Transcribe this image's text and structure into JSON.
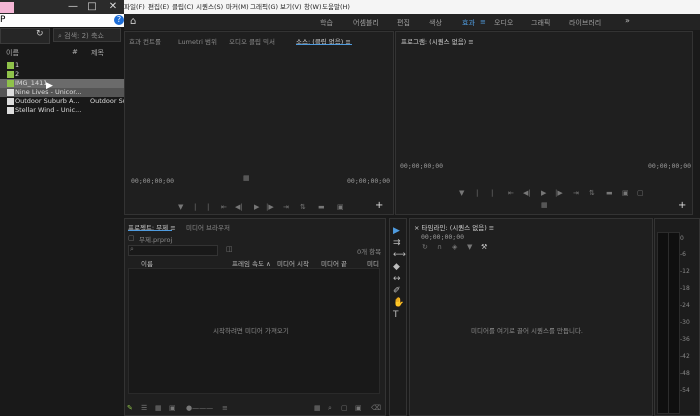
{
  "explorer": {
    "title_char": "P",
    "search_placeholder": "⌕ 검색: 2) 축쇼",
    "col_name": "이름",
    "col_hash": "#",
    "col_title": "제목",
    "help": "?",
    "refresh": "↻",
    "items": [
      {
        "label": "1",
        "extra": "",
        "type": "folder"
      },
      {
        "label": "2",
        "extra": "",
        "type": "folder"
      },
      {
        "label": "IMG_1411",
        "extra": "",
        "type": "folder"
      },
      {
        "label": "Nine Lives - Unicor...",
        "extra": "",
        "type": "file"
      },
      {
        "label": "Outdoor Suburb A...",
        "extra": "Outdoor Suburb",
        "type": "file"
      },
      {
        "label": "Stellar Wind - Unic...",
        "extra": "",
        "type": "file"
      }
    ],
    "win_min": "—",
    "win_max": "□",
    "win_close": "✕"
  },
  "menubar": {
    "items": [
      "파일(F)",
      "편집(E)",
      "클립(C)",
      "시퀀스(S)",
      "마커(M)",
      "그래픽(G)",
      "보기(V)",
      "창(W)",
      "도움말(H)"
    ]
  },
  "workspaces": {
    "home": "⌂",
    "items": [
      "학습",
      "어셈블리",
      "편집",
      "색상",
      "효과",
      "≡",
      "오디오",
      "그래픽",
      "라이브러리"
    ],
    "active_index": 4,
    "more": "»"
  },
  "source_panel": {
    "tabs": [
      "효과 컨트롤",
      "Lumetri 범위",
      "오디오 클립 믹서",
      "소스: (클립 없음) ≡"
    ],
    "timecode_left": "00;00;00;00",
    "timecode_right": "00;00;00;00",
    "plus": "+"
  },
  "program_panel": {
    "tab": "프로그램: (시퀀스 없음) ≡",
    "timecode_left": "00;00;00;00",
    "timecode_right": "00;00;00;00",
    "plus": "+"
  },
  "project_panel": {
    "tabs": [
      "프로젝트: 무제 ≡",
      "미디어 브라우저"
    ],
    "project_file": "무제.prproj",
    "item_count": "0개 항목",
    "headers": [
      "이름",
      "프레임 속도 ∧",
      "미디어 시작",
      "미디어 끝",
      "미디"
    ],
    "empty_msg": "시작하려면 미디어 가져오기"
  },
  "timeline_panel": {
    "tab": "× 타임라인: (시퀀스 없음) ≡",
    "timecode": "00;00;00;00",
    "empty_msg": "미디어를 여기로 끌어 시퀀스를 만듭니다."
  },
  "meter": {
    "ticks": [
      "0",
      "-6",
      "-12",
      "-18",
      "-24",
      "-30",
      "-36",
      "-42",
      "-48",
      "-54"
    ]
  }
}
